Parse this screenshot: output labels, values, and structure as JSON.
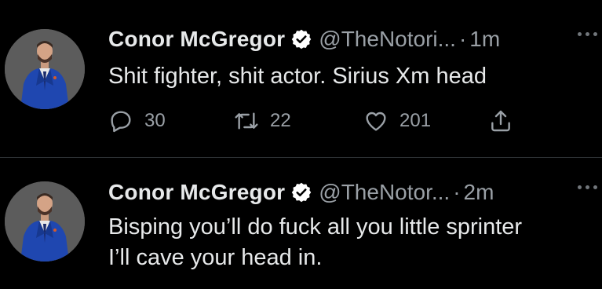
{
  "colors": {
    "background": "#000000",
    "primary_text": "#e7e9ea",
    "secondary_text": "#9aa0a6",
    "verified_badge": "#ffffff",
    "divider": "#2f3336",
    "suit": "#1f47b0"
  },
  "tweets": [
    {
      "author": {
        "name": "Conor McGregor",
        "handle": "@TheNotori...",
        "avatar_icon": "profile-photo-blue-suit",
        "verified": true
      },
      "separator": "·",
      "time": "1m",
      "text_lines": [
        "Shit fighter, shit actor. Sirius Xm head"
      ],
      "actions": {
        "reply": {
          "icon": "reply-icon",
          "count": "30"
        },
        "retweet": {
          "icon": "retweet-icon",
          "count": "22"
        },
        "like": {
          "icon": "heart-icon",
          "count": "201"
        },
        "share": {
          "icon": "share-icon"
        }
      },
      "more_icon": "more-horizontal-icon"
    },
    {
      "author": {
        "name": "Conor McGregor",
        "handle": "@TheNotor...",
        "avatar_icon": "profile-photo-blue-suit",
        "verified": true
      },
      "separator": "·",
      "time": "2m",
      "text_lines": [
        "Bisping you’ll do fuck all you little sprinter",
        "I’ll cave your head in."
      ],
      "more_icon": "more-horizontal-icon"
    }
  ]
}
